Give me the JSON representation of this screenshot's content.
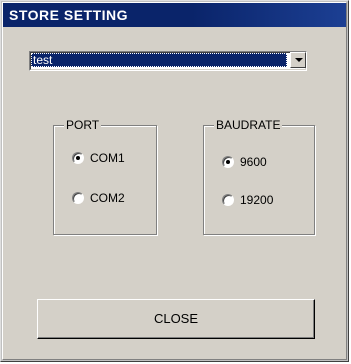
{
  "window": {
    "title": "STORE SETTING"
  },
  "store_select": {
    "selected": "test"
  },
  "port": {
    "title": "PORT",
    "options": [
      {
        "label": "COM1",
        "checked": true
      },
      {
        "label": "COM2",
        "checked": false
      }
    ]
  },
  "baudrate": {
    "title": "BAUDRATE",
    "options": [
      {
        "label": "9600",
        "checked": true
      },
      {
        "label": "19200",
        "checked": false
      }
    ]
  },
  "close_button": {
    "label": "CLOSE"
  },
  "colors": {
    "titlebar": "#0a246a",
    "face": "#d4d0c8",
    "selection": "#0a246a"
  }
}
